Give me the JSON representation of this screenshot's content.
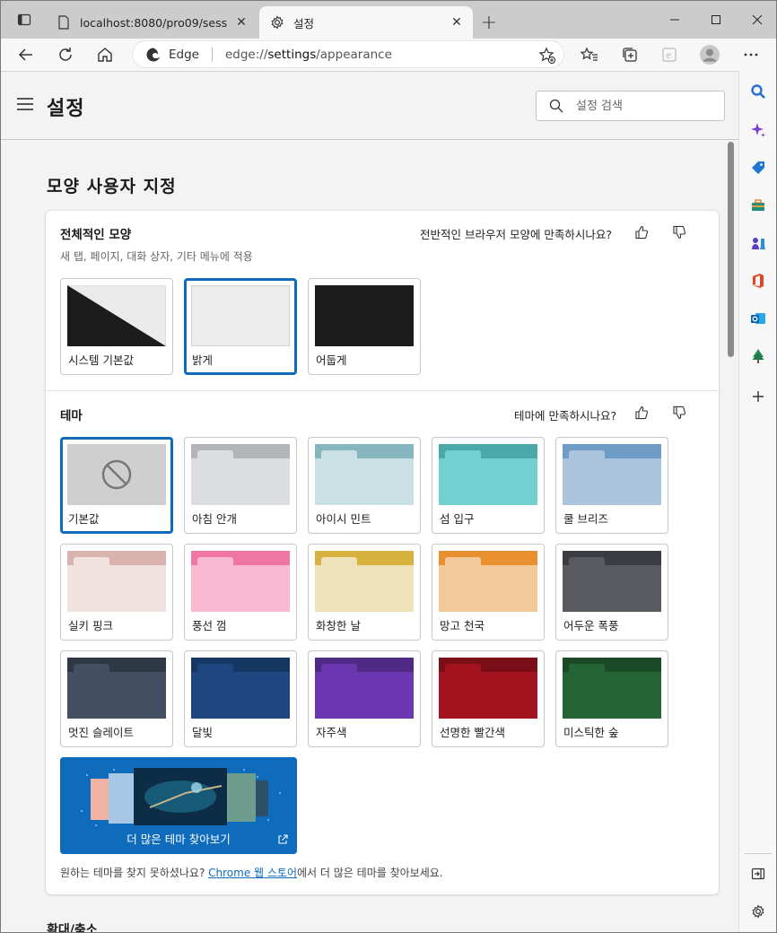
{
  "tabs": [
    {
      "title": "localhost:8080/pro09/sess",
      "icon": "page-icon",
      "active": false
    },
    {
      "title": "설정",
      "icon": "gear-icon",
      "active": true
    }
  ],
  "address_bar": {
    "brand": "Edge",
    "url_scheme": "edge://",
    "url_host": "settings",
    "url_path": "/appearance"
  },
  "header": {
    "title": "설정",
    "search_placeholder": "설정 검색"
  },
  "page_title": "모양 사용자 지정",
  "overall": {
    "title": "전체적인 모양",
    "subtitle": "새 탭, 페이지, 대화 상자, 기타 메뉴에 적용",
    "feedback": "전반적인 브라우저 모양에 만족하시나요?",
    "options": [
      {
        "label": "시스템 기본값",
        "selected": false
      },
      {
        "label": "밝게",
        "selected": true
      },
      {
        "label": "어둡게",
        "selected": false
      }
    ]
  },
  "theme": {
    "title": "테마",
    "feedback": "테마에 만족하시나요?",
    "options": [
      {
        "label": "기본값",
        "selected": true,
        "band": "#cfcfcf",
        "body": "#cfcfcf",
        "tab": "#cfcfcf"
      },
      {
        "label": "아침 안개",
        "selected": false,
        "band": "#b2b4b8",
        "body": "#dcdde0",
        "tab": "#dcdde0"
      },
      {
        "label": "아이시 민트",
        "selected": false,
        "band": "#86b7c0",
        "body": "#c9e0e4",
        "tab": "#c9e0e4"
      },
      {
        "label": "섬 입구",
        "selected": false,
        "band": "#4aa9a8",
        "body": "#74d0d0",
        "tab": "#74d0d0"
      },
      {
        "label": "쿨 브리즈",
        "selected": false,
        "band": "#6f9cc6",
        "body": "#a9c4dc",
        "tab": "#a9c4dc"
      },
      {
        "label": "실키 핑크",
        "selected": false,
        "band": "#d9b4ae",
        "body": "#f1e2e0",
        "tab": "#f1e2e0"
      },
      {
        "label": "풍선 껌",
        "selected": false,
        "band": "#ef76a3",
        "body": "#f7b8d0",
        "tab": "#f7b8d0"
      },
      {
        "label": "화창한 날",
        "selected": false,
        "band": "#d8b23e",
        "body": "#efe2b8",
        "tab": "#efe2b8"
      },
      {
        "label": "망고 천국",
        "selected": false,
        "band": "#e8902f",
        "body": "#f3c99c",
        "tab": "#f3c99c"
      },
      {
        "label": "어두운 폭풍",
        "selected": false,
        "band": "#3b3c41",
        "body": "#5a5b61",
        "tab": "#5a5b61"
      },
      {
        "label": "멋진 슬레이트",
        "selected": false,
        "band": "#2e3744",
        "body": "#434f63",
        "tab": "#434f63"
      },
      {
        "label": "달빛",
        "selected": false,
        "band": "#173763",
        "body": "#1f477f",
        "tab": "#1f477f"
      },
      {
        "label": "자주색",
        "selected": false,
        "band": "#4f2a87",
        "body": "#6b37b0",
        "tab": "#6b37b0"
      },
      {
        "label": "선명한 빨간색",
        "selected": false,
        "band": "#7b0f17",
        "body": "#a3131f",
        "tab": "#a3131f"
      },
      {
        "label": "미스틱한 숲",
        "selected": false,
        "band": "#1b4a26",
        "body": "#246432",
        "tab": "#246432"
      }
    ],
    "more_themes": "더 많은 테마 찾아보기",
    "footer_prefix": "원하는 테마를 찾지 못하셨나요? ",
    "footer_link": "Chrome 웹 스토어",
    "footer_suffix": "에서 더 많은 테마를 찾아보세요."
  },
  "next_section": "확대/축소",
  "colors": {
    "accent": "#0f6cbd"
  }
}
